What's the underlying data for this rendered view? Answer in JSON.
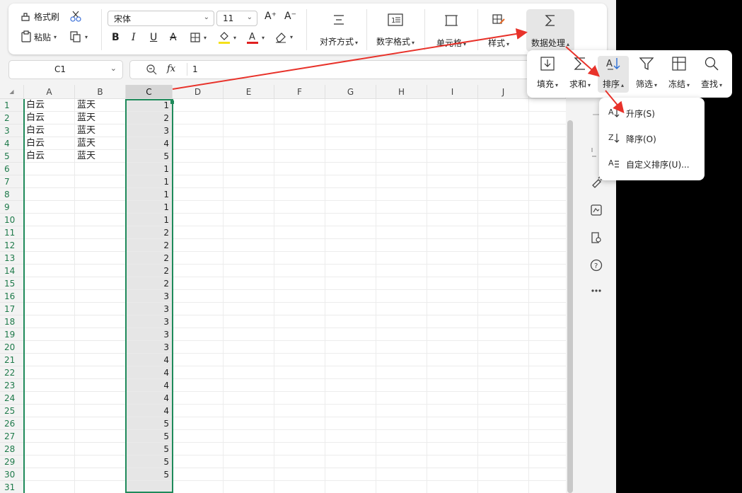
{
  "toolbar": {
    "format_painter": "格式刷",
    "paste": "粘贴",
    "font_name": "宋体",
    "font_size": "11",
    "bold": "B",
    "italic": "I",
    "underline": "U",
    "strike": "A",
    "align": "对齐方式",
    "number_format": "数字格式",
    "cells": "单元格",
    "styles": "样式",
    "data_processing": "数据处理",
    "font_color": "#e02020",
    "highlight_color": "#f5e11a",
    "accent": "#1f8a5a"
  },
  "formula_bar": {
    "cell_ref": "C1",
    "fx": "fx",
    "value": "1"
  },
  "sheet": {
    "columns": [
      "A",
      "B",
      "C",
      "D",
      "E",
      "F",
      "G",
      "H",
      "I",
      "J"
    ],
    "selected_column": "C",
    "rows": [
      {
        "n": "1",
        "a": "白云",
        "b": "蓝天",
        "c": "1"
      },
      {
        "n": "2",
        "a": "白云",
        "b": "蓝天",
        "c": "2"
      },
      {
        "n": "3",
        "a": "白云",
        "b": "蓝天",
        "c": "3"
      },
      {
        "n": "4",
        "a": "白云",
        "b": "蓝天",
        "c": "4"
      },
      {
        "n": "5",
        "a": "白云",
        "b": "蓝天",
        "c": "5"
      },
      {
        "n": "6",
        "a": "",
        "b": "",
        "c": "1"
      },
      {
        "n": "7",
        "a": "",
        "b": "",
        "c": "1"
      },
      {
        "n": "8",
        "a": "",
        "b": "",
        "c": "1"
      },
      {
        "n": "9",
        "a": "",
        "b": "",
        "c": "1"
      },
      {
        "n": "10",
        "a": "",
        "b": "",
        "c": "1"
      },
      {
        "n": "11",
        "a": "",
        "b": "",
        "c": "2"
      },
      {
        "n": "12",
        "a": "",
        "b": "",
        "c": "2"
      },
      {
        "n": "13",
        "a": "",
        "b": "",
        "c": "2"
      },
      {
        "n": "14",
        "a": "",
        "b": "",
        "c": "2"
      },
      {
        "n": "15",
        "a": "",
        "b": "",
        "c": "2"
      },
      {
        "n": "16",
        "a": "",
        "b": "",
        "c": "3"
      },
      {
        "n": "17",
        "a": "",
        "b": "",
        "c": "3"
      },
      {
        "n": "18",
        "a": "",
        "b": "",
        "c": "3"
      },
      {
        "n": "19",
        "a": "",
        "b": "",
        "c": "3"
      },
      {
        "n": "20",
        "a": "",
        "b": "",
        "c": "3"
      },
      {
        "n": "21",
        "a": "",
        "b": "",
        "c": "4"
      },
      {
        "n": "22",
        "a": "",
        "b": "",
        "c": "4"
      },
      {
        "n": "23",
        "a": "",
        "b": "",
        "c": "4"
      },
      {
        "n": "24",
        "a": "",
        "b": "",
        "c": "4"
      },
      {
        "n": "25",
        "a": "",
        "b": "",
        "c": "4"
      },
      {
        "n": "26",
        "a": "",
        "b": "",
        "c": "5"
      },
      {
        "n": "27",
        "a": "",
        "b": "",
        "c": "5"
      },
      {
        "n": "28",
        "a": "",
        "b": "",
        "c": "5"
      },
      {
        "n": "29",
        "a": "",
        "b": "",
        "c": "5"
      },
      {
        "n": "30",
        "a": "",
        "b": "",
        "c": "5"
      },
      {
        "n": "31",
        "a": "",
        "b": "",
        "c": ""
      }
    ]
  },
  "data_popup": {
    "fill": "填充",
    "sum": "求和",
    "sort": "排序",
    "filter": "筛选",
    "freeze": "冻结",
    "find": "查找"
  },
  "sort_menu": {
    "ascending": "升序(S)",
    "descending": "降序(O)",
    "custom": "自定义排序(U)..."
  },
  "annotation_color": "#e8322a"
}
